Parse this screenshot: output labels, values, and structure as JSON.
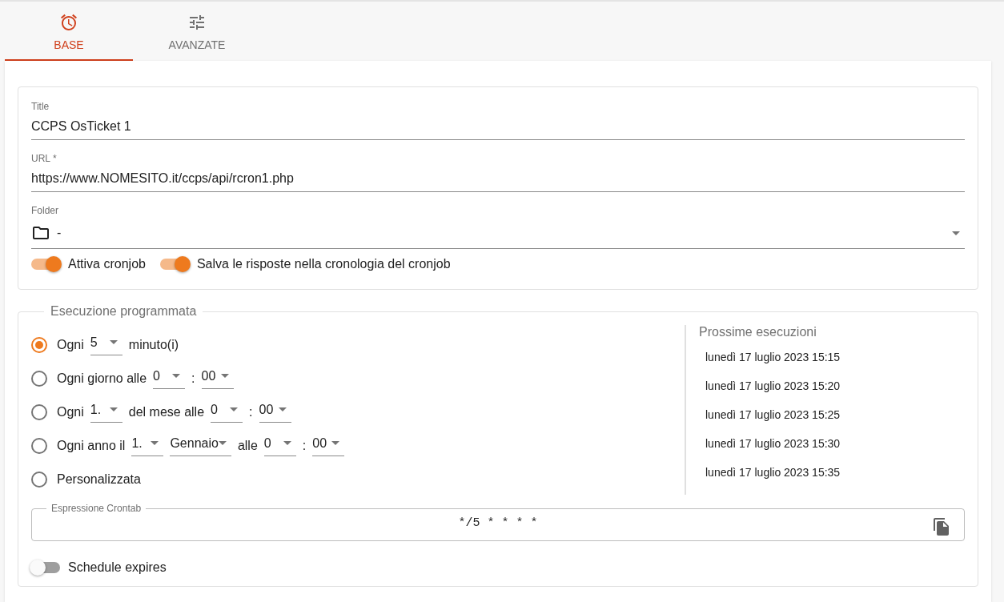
{
  "tabs": [
    {
      "label": "BASE",
      "selected": true
    },
    {
      "label": "AVANZATE",
      "selected": false
    }
  ],
  "fields": [
    {
      "kind": "text",
      "label": "Title",
      "value": "CCPS OsTicket 1"
    },
    {
      "kind": "text",
      "label": "URL *",
      "value": "https://www.NOMESITO.it/ccps/api/rcron1.php"
    },
    {
      "kind": "folder",
      "label": "Folder",
      "value": "-"
    }
  ],
  "toggles": [
    {
      "label": "Attiva cronjob",
      "on": true
    },
    {
      "label": "Salva le risposte nella cronologia del cronjob",
      "on": true
    }
  ],
  "schedule": {
    "legend": "Esecuzione programmata",
    "options": [
      {
        "selected": true,
        "parts": [
          {
            "kind": "text",
            "text": "Ogni"
          },
          {
            "kind": "select",
            "value": "5"
          },
          {
            "kind": "text",
            "text": "minuto(i)"
          }
        ]
      },
      {
        "selected": false,
        "parts": [
          {
            "kind": "text",
            "text": "Ogni giorno alle"
          },
          {
            "kind": "select",
            "value": "0"
          },
          {
            "kind": "text",
            "text": ":"
          },
          {
            "kind": "select",
            "value": "00"
          }
        ]
      },
      {
        "selected": false,
        "parts": [
          {
            "kind": "text",
            "text": "Ogni"
          },
          {
            "kind": "select",
            "value": "1."
          },
          {
            "kind": "text",
            "text": "del mese alle"
          },
          {
            "kind": "select",
            "value": "0"
          },
          {
            "kind": "text",
            "text": ":"
          },
          {
            "kind": "select",
            "value": "00"
          }
        ]
      },
      {
        "selected": false,
        "parts": [
          {
            "kind": "text",
            "text": "Ogni anno il"
          },
          {
            "kind": "select",
            "value": "1."
          },
          {
            "kind": "select",
            "value": "Gennaio"
          },
          {
            "kind": "text",
            "text": "alle"
          },
          {
            "kind": "select",
            "value": "0"
          },
          {
            "kind": "text",
            "text": ":"
          },
          {
            "kind": "select",
            "value": "00"
          }
        ]
      },
      {
        "selected": false,
        "parts": [
          {
            "kind": "text",
            "text": "Personalizzata"
          }
        ]
      }
    ],
    "next_runs": {
      "title": "Prossime esecuzioni",
      "items": [
        "lunedì 17 luglio 2023 15:15",
        "lunedì 17 luglio 2023 15:20",
        "lunedì 17 luglio 2023 15:25",
        "lunedì 17 luglio 2023 15:30",
        "lunedì 17 luglio 2023 15:35"
      ]
    },
    "crontab": {
      "label": "Espressione Crontab",
      "value": "*/5 * * * *"
    },
    "expires": {
      "label": "Schedule expires",
      "on": false
    }
  }
}
